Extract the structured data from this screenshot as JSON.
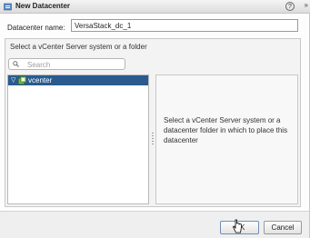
{
  "dialog": {
    "title": "New Datacenter",
    "help_icon": "?",
    "expand_icon": "»"
  },
  "form": {
    "name_label": "Datacenter name:",
    "name_value": "VersaStack_dc_1"
  },
  "location": {
    "label": "Select a vCenter Server system or a folder",
    "search_placeholder": "Search",
    "tree": [
      {
        "label": "vcenter",
        "icon": "vcenter-server-icon",
        "expanded": true,
        "selected": true
      }
    ],
    "info_text": "Select a vCenter Server system or a datacenter folder in which to place this datacenter"
  },
  "footer": {
    "ok_label": "OK",
    "cancel_label": "Cancel"
  },
  "colors": {
    "selection": "#295b8e",
    "title_icon": "#5a8ac6"
  }
}
